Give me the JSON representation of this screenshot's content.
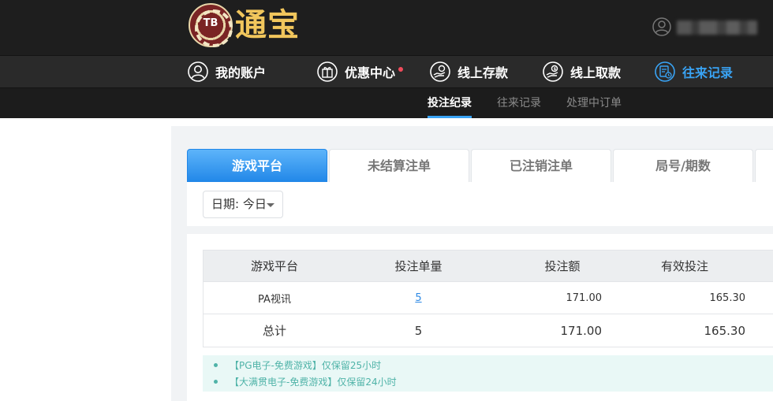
{
  "header": {
    "logo_badge": "TB",
    "logo_text": "通宝",
    "user_name": "•••••••••••"
  },
  "nav": {
    "items": [
      {
        "label": "我的账户",
        "icon": "user-circle-icon"
      },
      {
        "label": "优惠中心",
        "icon": "gift-icon",
        "has_dot": true
      },
      {
        "label": "线上存款",
        "icon": "deposit-hand-icon"
      },
      {
        "label": "线上取款",
        "icon": "withdraw-hand-icon"
      },
      {
        "label": "往来记录",
        "icon": "records-icon",
        "active": true
      }
    ]
  },
  "subnav": {
    "items": [
      {
        "label": "投注纪录",
        "active": true
      },
      {
        "label": "往来记录"
      },
      {
        "label": "处理中订单"
      }
    ]
  },
  "tabs": [
    {
      "label": "游戏平台",
      "active": true
    },
    {
      "label": "未结算注单"
    },
    {
      "label": "已注销注单"
    },
    {
      "label": "局号/期数"
    }
  ],
  "filter": {
    "date_label": "日期: 今日"
  },
  "table": {
    "headers": [
      "游戏平台",
      "投注单量",
      "投注额",
      "有效投注"
    ],
    "rows": [
      {
        "platform": "PA视讯",
        "count": "5",
        "amount": "171.00",
        "valid": "165.30"
      }
    ],
    "total": {
      "label": "总计",
      "count": "5",
      "amount": "171.00",
      "valid": "165.30"
    }
  },
  "notes": [
    "【PG电子-免费游戏】仅保留25小时",
    "【大满贯电子-免费游戏】仅保留24小时"
  ],
  "colors": {
    "accent": "#39a3f4",
    "header_bg": "#1e1e1e",
    "note_text": "#4fb3a8",
    "dot": "#f04b5b"
  }
}
